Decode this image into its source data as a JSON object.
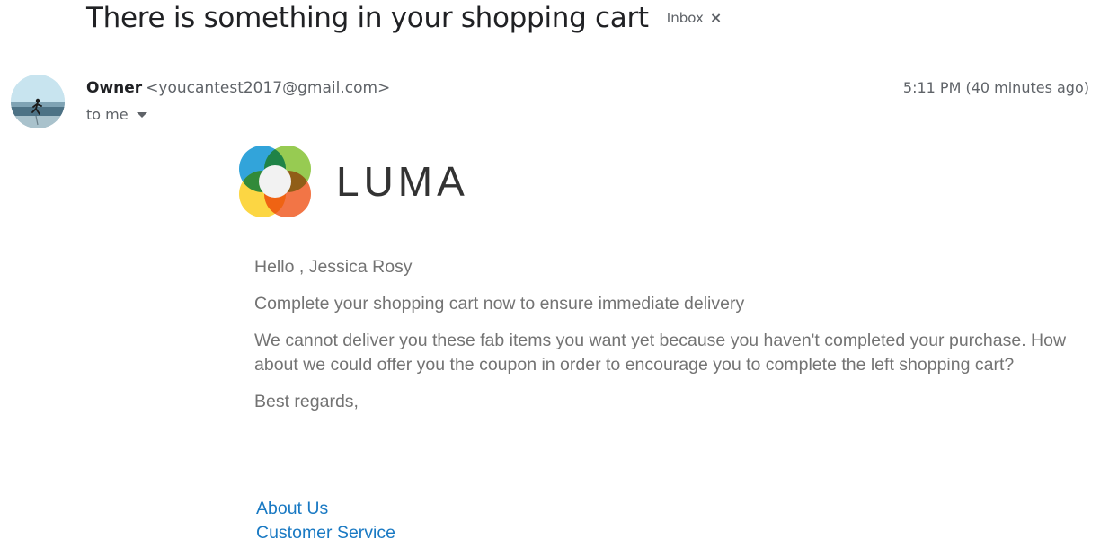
{
  "email": {
    "subject": "There is something in your shopping cart",
    "label": "Inbox",
    "label_remove_glyph": "×",
    "sender": {
      "name": "Owner",
      "email": "<youcantest2017@gmail.com>"
    },
    "timestamp": "5:11 PM (40 minutes ago)",
    "recipient": "to me"
  },
  "message": {
    "logo_text": "LUMA",
    "greeting": "Hello , Jessica Rosy",
    "headline": "Complete your shopping cart now to ensure immediate delivery",
    "paragraph": "We cannot deliver you these fab items you want yet because you haven't completed your purchase. How about we could offer you the coupon in order to encourage you to complete the left shopping cart?",
    "signoff": "Best regards,",
    "footer_links": [
      "About Us",
      "Customer Service"
    ]
  },
  "colors": {
    "link": "#1979c3",
    "body_text": "#737373",
    "logo_blue": "#1c9ad6",
    "logo_green": "#8cc63f",
    "logo_yellow": "#fcd22e",
    "logo_orange": "#f16631"
  }
}
